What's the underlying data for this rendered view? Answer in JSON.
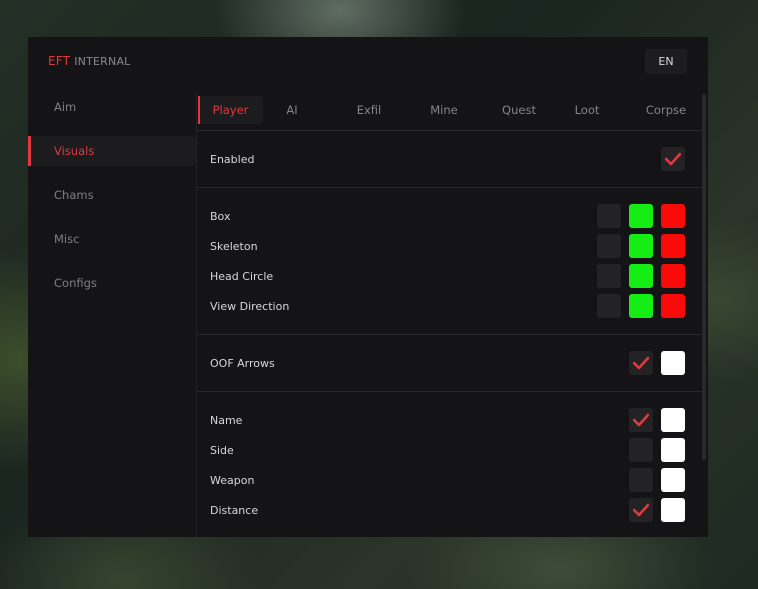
{
  "header": {
    "brand_primary": "EFT",
    "brand_secondary": "INTERNAL",
    "language": "EN"
  },
  "sidebar": {
    "items": [
      {
        "label": "Aim",
        "active": false
      },
      {
        "label": "Visuals",
        "active": true
      },
      {
        "label": "Chams",
        "active": false
      },
      {
        "label": "Misc",
        "active": false
      },
      {
        "label": "Configs",
        "active": false
      }
    ]
  },
  "tabs": [
    {
      "label": "Player",
      "active": true
    },
    {
      "label": "AI",
      "active": false
    },
    {
      "label": "Exfil",
      "active": false
    },
    {
      "label": "Mine",
      "active": false
    },
    {
      "label": "Quest",
      "active": false
    },
    {
      "label": "Loot",
      "active": false
    },
    {
      "label": "Corpse",
      "active": false
    }
  ],
  "settings": {
    "enabled": {
      "label": "Enabled",
      "checked": true
    },
    "box": {
      "label": "Box",
      "checked": false,
      "color_visible": "#14ee14",
      "color_hidden": "#fb0a0a"
    },
    "skeleton": {
      "label": "Skeleton",
      "checked": false,
      "color_visible": "#14ee14",
      "color_hidden": "#fb0a0a"
    },
    "head_circle": {
      "label": "Head Circle",
      "checked": false,
      "color_visible": "#14ee14",
      "color_hidden": "#fb0a0a"
    },
    "view_direction": {
      "label": "View Direction",
      "checked": false,
      "color_visible": "#14ee14",
      "color_hidden": "#fb0a0a"
    },
    "oof_arrows": {
      "label": "OOF Arrows",
      "checked": true,
      "color": "#ffffff"
    },
    "name": {
      "label": "Name",
      "checked": true,
      "color": "#ffffff"
    },
    "side": {
      "label": "Side",
      "checked": false,
      "color": "#ffffff"
    },
    "weapon": {
      "label": "Weapon",
      "checked": false,
      "color": "#ffffff"
    },
    "distance": {
      "label": "Distance",
      "checked": true,
      "color": "#ffffff"
    }
  },
  "colors": {
    "accent": "#e0383e",
    "background": "#141416",
    "checkbox_bg": "#232326"
  }
}
